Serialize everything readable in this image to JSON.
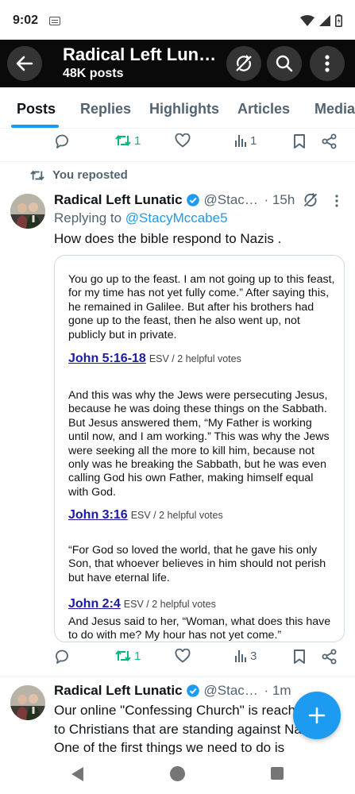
{
  "status": {
    "time": "9:02"
  },
  "header": {
    "title": "Radical Left Lunatic",
    "subtitle": "48K posts"
  },
  "tabs": [
    "Posts",
    "Replies",
    "Highlights",
    "Articles",
    "Media"
  ],
  "prev_tweet": {
    "retweets": "1",
    "views": "1"
  },
  "repost_banner": "You reposted",
  "tweet": {
    "name": "Radical Left Lunatic",
    "handle": "@StacyMccabe5",
    "time": "· 15h",
    "replying_prefix": "Replying to",
    "replying_to": "@StacyMccabe5",
    "text": "How does the bible respond to Nazis .",
    "card": {
      "intro": "You go up to the feast. I am not going up to this feast, for my time has not yet fully come.” After saying this, he remained in Galilee. But after his brothers had gone up to the feast, then he also went up, not publicly but in private.",
      "ref1": "John 5:16-18",
      "ref1_meta": "ESV / 2 helpful votes",
      "verse1": "And this was why the Jews were persecuting Jesus, because he was doing these things on the Sabbath. But Jesus answered them, “My Father is working until now, and I am working.” This was why the Jews were seeking all the more to kill him, because not only was he breaking the Sabbath, but he was even calling God his own Father, making himself equal with God.",
      "ref2": "John 3:16",
      "ref2_meta": "ESV / 2 helpful votes",
      "verse2": "“For God so loved the world, that he gave his only Son, that whoever believes in him should not perish but have eternal life.",
      "ref3": "John 2:4",
      "ref3_meta": "ESV / 2 helpful votes",
      "verse3": "And Jesus said to her, “Woman, what does this have to do with me? My hour has not yet come.”"
    },
    "retweets": "1",
    "views": "3"
  },
  "tweet2": {
    "name": "Radical Left Lunatic",
    "handle": "@StacyMccabe5",
    "time": "· 1m",
    "text": "Our online \"Confessing Church\" is reaching out to Christians that are standing against Nazis. One of the first things we need to do is"
  },
  "colors": {
    "accent": "#1d9bf0",
    "retweet": "#00ba7c",
    "header_bg": "#0a0a0a",
    "link_blue": "#1a1aa6"
  }
}
